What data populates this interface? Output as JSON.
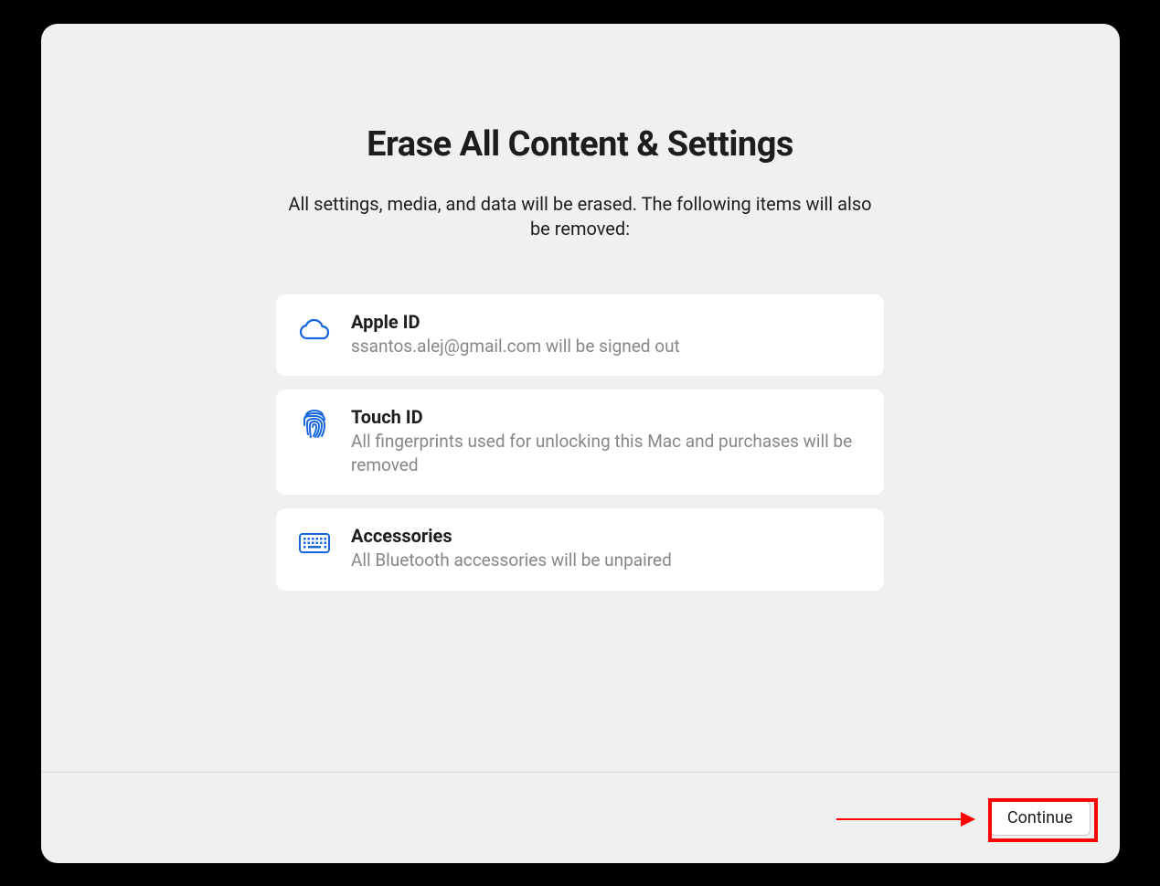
{
  "header": {
    "title": "Erase All Content & Settings",
    "subtitle": "All settings, media, and data will be erased. The following items will also be removed:"
  },
  "items": [
    {
      "icon": "cloud-icon",
      "title": "Apple ID",
      "description": "ssantos.alej@gmail.com will be signed out"
    },
    {
      "icon": "fingerprint-icon",
      "title": "Touch ID",
      "description": "All fingerprints used for unlocking this Mac and purchases will be removed"
    },
    {
      "icon": "keyboard-icon",
      "title": "Accessories",
      "description": "All Bluetooth accessories will be unpaired"
    }
  ],
  "footer": {
    "continue_label": "Continue"
  },
  "accent_color": "#1666e0"
}
